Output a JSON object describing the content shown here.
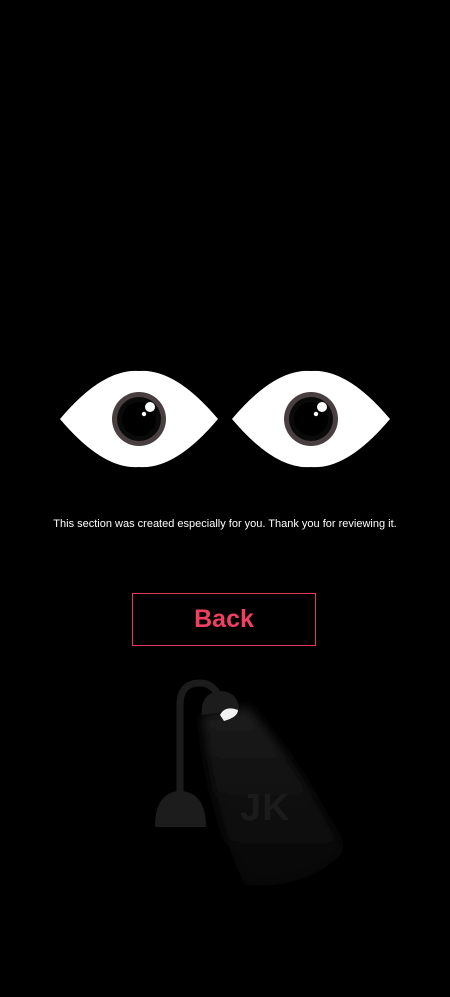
{
  "message": "This section was created especially for you. Thank you for reviewing it.",
  "back_button": {
    "label": "Back"
  },
  "watermark": "JK",
  "colors": {
    "background": "#000000",
    "accent": "#ef4062",
    "eye_white": "#ffffff",
    "iris_ring": "#4a3f40"
  },
  "icons": {
    "left_eye": "eye-icon",
    "right_eye": "eye-icon",
    "lamp": "desk-lamp-icon"
  }
}
